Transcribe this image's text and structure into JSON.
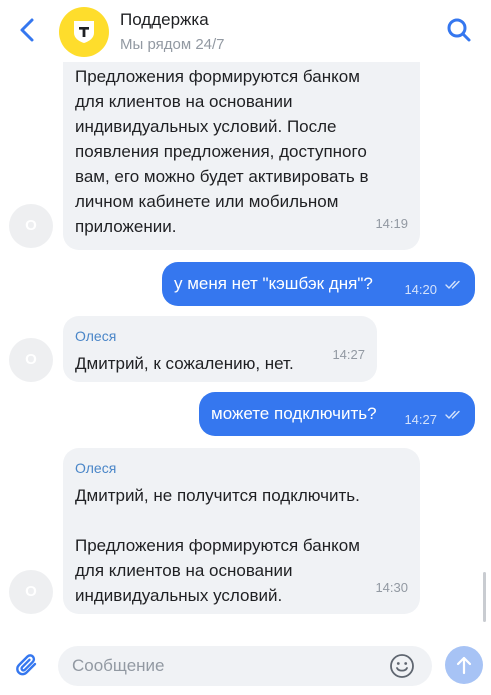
{
  "header": {
    "title": "Поддержка",
    "subtitle": "Мы рядом 24/7",
    "back_icon": "chevron-left-icon",
    "search_icon": "search-icon",
    "logo_icon": "tinkoff-shield-icon"
  },
  "messages": [
    {
      "direction": "in",
      "text": "Предложения формируются банком\nдля клиентов на основании\nиндивидуальных условий. После\nпоявления предложения, доступного\nвам, его можно будет активировать в\nличном кабинете или мобильном\nприложении.",
      "time": "14:19",
      "avatar": "О"
    },
    {
      "direction": "out",
      "text": "у меня нет \"кэшбэк дня\"?",
      "time": "14:20"
    },
    {
      "direction": "in",
      "sender": "Олеся",
      "text": "Дмитрий, к сожалению, нет.",
      "time": "14:27",
      "avatar": "О"
    },
    {
      "direction": "out",
      "text": "можете подключить?",
      "time": "14:27"
    },
    {
      "direction": "in",
      "sender": "Олеся",
      "text": "Дмитрий, не получится подключить.\n\nПредложения формируются банком\nдля клиентов на основании\nиндивидуальных условий.",
      "time": "14:30",
      "avatar": "О"
    }
  ],
  "composer": {
    "placeholder": "Сообщение",
    "attach_icon": "paperclip-icon",
    "emoji_icon": "emoji-icon",
    "send_icon": "send-arrow-icon"
  },
  "colors": {
    "accent": "#3577ef",
    "incoming_bubble": "#f0f2f5",
    "logo": "#fedd2c",
    "muted_text": "#9299a2",
    "sender_name": "#4a86c8"
  }
}
